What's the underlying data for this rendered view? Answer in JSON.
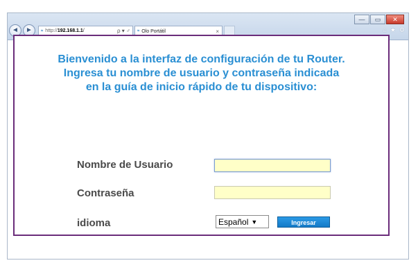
{
  "browser": {
    "window_buttons": {
      "minimize": "—",
      "maximize": "▭",
      "close": "✕"
    },
    "nav": {
      "back_icon": "◄",
      "forward_icon": "►"
    },
    "address": {
      "protocol": "http://",
      "host": "192.168.1.1",
      "suffix": "/",
      "tools": "ρ ▾ ♂"
    },
    "tab": {
      "title": "Olo Portátil",
      "close": "×"
    },
    "commands": {
      "home": "⌂",
      "favorites": "★",
      "settings": "⚙"
    }
  },
  "login": {
    "welcome_lines": [
      "Bienvenido a la interfaz de configuración de tu Router.",
      "Ingresa tu nombre de usuario y contraseña indicada",
      "en la guía de inicio rápido de tu dispositivo:"
    ],
    "username_label": "Nombre de Usuario",
    "password_label": "Contraseña",
    "language_label": "idioma",
    "language_value": "Español",
    "language_arrow": "▼",
    "submit_label": "Ingresar",
    "colors": {
      "welcome_text": "#2a8fd3",
      "border": "#6a2c7a",
      "input_bg": "#ffffc8",
      "button": "#1a89d6"
    }
  }
}
